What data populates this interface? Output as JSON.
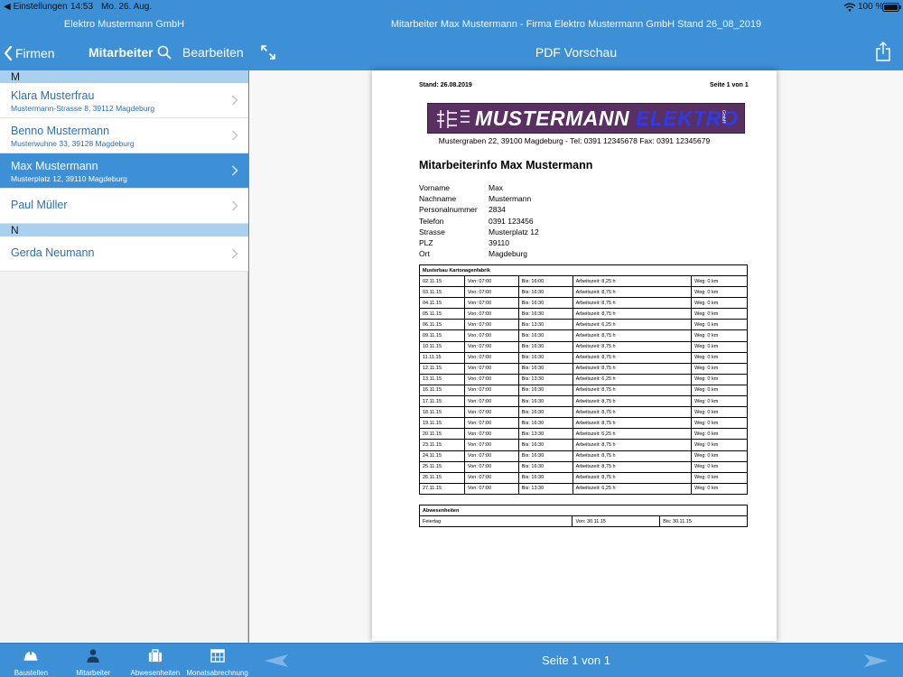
{
  "status_bar": {
    "back_app": "◀ Einstellungen",
    "time": "14:53",
    "date": "Mo. 26. Aug.",
    "battery": "100 %"
  },
  "left_header": {
    "app_title": "Elektro Mustermann GmbH",
    "back_label": "Firmen",
    "title": "Mitarbeiter",
    "edit_label": "Bearbeiten"
  },
  "sections": [
    {
      "letter": "M",
      "people": [
        {
          "name": "Klara Musterfrau",
          "address": "Mustermann-Strasse 8, 39112 Magdeburg"
        },
        {
          "name": "Benno Mustermann",
          "address": "Musterwuhne 33, 39128 Magdeburg"
        },
        {
          "name": "Max Mustermann",
          "address": "Musterplatz 12, 39110 Magdeburg"
        },
        {
          "name": "Paul Müller",
          "address": ""
        }
      ]
    },
    {
      "letter": "N",
      "people": [
        {
          "name": "Gerda Neumann",
          "address": ""
        }
      ]
    }
  ],
  "tabs": [
    {
      "label": "Baustellen",
      "icon": "helmet-icon"
    },
    {
      "label": "Mitarbeiter",
      "icon": "worker-icon"
    },
    {
      "label": "Abwesenheiten",
      "icon": "suitcase-icon"
    },
    {
      "label": "Monatsabrechnung",
      "icon": "calendar-icon"
    }
  ],
  "right_header": {
    "doc_title": "Mitarbeiter Max Mustermann - Firma Elektro Mustermann GmbH Stand 26_08_2019",
    "title": "PDF Vorschau"
  },
  "bottom_bar": {
    "page_indicator": "Seite 1 von 1"
  },
  "pdf": {
    "stand": "Stand: 26.08.2019",
    "page": "Seite 1 von 1",
    "logo_main": "MUSTERMANN",
    "logo_accent": "ELEKTRO",
    "logo_gmbh": "GmbH",
    "company_line": "Mustergraben 22, 39100 Magdeburg  -  Tel: 0391 12345678 Fax: 0391 12345679",
    "heading": "Mitarbeiterinfo Max Mustermann",
    "info": [
      {
        "label": "Vorname",
        "value": "Max"
      },
      {
        "label": "Nachname",
        "value": "Mustermann"
      },
      {
        "label": "Personalnummer",
        "value": "2834"
      },
      {
        "label": "Telefon",
        "value": "0391 123456"
      },
      {
        "label": "Strasse",
        "value": "Musterplatz 12"
      },
      {
        "label": "PLZ",
        "value": "39110"
      },
      {
        "label": "Ort",
        "value": "Magdeburg"
      }
    ],
    "work_table": {
      "title": "Musterbau Kartonagenfabrik",
      "rows": [
        [
          "02.11.15",
          "Von: 07:00",
          "Bis: 16:00",
          "Arbeitszeit: 8,25 h",
          "Weg: 0 km"
        ],
        [
          "03.11.15",
          "Von: 07:00",
          "Bis: 16:30",
          "Arbeitszeit: 8,75 h",
          "Weg: 0 km"
        ],
        [
          "04.11.15",
          "Von: 07:00",
          "Bis: 16:30",
          "Arbeitszeit: 8,75 h",
          "Weg: 0 km"
        ],
        [
          "05.11.15",
          "Von: 07:00",
          "Bis: 16:30",
          "Arbeitszeit: 8,75 h",
          "Weg: 0 km"
        ],
        [
          "06.11.15",
          "Von: 07:00",
          "Bis: 13:30",
          "Arbeitszeit: 6,25 h",
          "Weg: 0 km"
        ],
        [
          "09.11.15",
          "Von: 07:00",
          "Bis: 16:30",
          "Arbeitszeit: 8,75 h",
          "Weg: 0 km"
        ],
        [
          "10.11.15",
          "Von: 07:00",
          "Bis: 16:30",
          "Arbeitszeit: 8,75 h",
          "Weg: 0 km"
        ],
        [
          "11.11.15",
          "Von: 07:00",
          "Bis: 16:30",
          "Arbeitszeit: 8,75 h",
          "Weg: 0 km"
        ],
        [
          "12.11.15",
          "Von: 07:00",
          "Bis: 16:30",
          "Arbeitszeit: 8,75 h",
          "Weg: 0 km"
        ],
        [
          "13.11.15",
          "Von: 07:00",
          "Bis: 13:30",
          "Arbeitszeit: 6,25 h",
          "Weg: 0 km"
        ],
        [
          "16.11.15",
          "Von: 07:00",
          "Bis: 16:30",
          "Arbeitszeit: 8,75 h",
          "Weg: 0 km"
        ],
        [
          "17.11.15",
          "Von: 07:00",
          "Bis: 16:30",
          "Arbeitszeit: 8,75 h",
          "Weg: 0 km"
        ],
        [
          "18.11.15",
          "Von: 07:00",
          "Bis: 16:30",
          "Arbeitszeit: 8,75 h",
          "Weg: 0 km"
        ],
        [
          "19.11.15",
          "Von: 07:00",
          "Bis: 16:30",
          "Arbeitszeit: 8,75 h",
          "Weg: 0 km"
        ],
        [
          "20.11.15",
          "Von: 07:00",
          "Bis: 13:30",
          "Arbeitszeit: 6,25 h",
          "Weg: 0 km"
        ],
        [
          "23.11.15",
          "Von: 07:00",
          "Bis: 16:30",
          "Arbeitszeit: 8,75 h",
          "Weg: 0 km"
        ],
        [
          "24.11.15",
          "Von: 07:00",
          "Bis: 16:30",
          "Arbeitszeit: 8,75 h",
          "Weg: 0 km"
        ],
        [
          "25.11.15",
          "Von: 07:00",
          "Bis: 16:30",
          "Arbeitszeit: 8,75 h",
          "Weg: 0 km"
        ],
        [
          "26.11.15",
          "Von: 07:00",
          "Bis: 16:30",
          "Arbeitszeit: 8,75 h",
          "Weg: 0 km"
        ],
        [
          "27.11.15",
          "Von: 07:00",
          "Bis: 13:30",
          "Arbeitszeit: 6,25 h",
          "Weg: 0 km"
        ]
      ]
    },
    "absence_table": {
      "title": "Abwesenheiten",
      "rows": [
        [
          "Feiertag",
          "Von: 30.11.15",
          "Bis: 30.11.15"
        ]
      ]
    }
  },
  "colors": {
    "accent": "#3d8fd6",
    "section_header": "#a9d0ee",
    "link_text": "#2c6fb3",
    "logo_bg": "#5a2f62",
    "logo_accent": "#2a3cf0"
  }
}
